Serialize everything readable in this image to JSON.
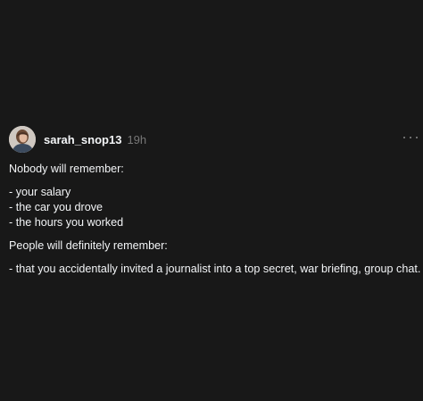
{
  "post": {
    "username": "sarah_snop13",
    "time": "19h",
    "avatar_icon": "profile-photo",
    "more_icon": "ellipsis-horizontal-icon",
    "paragraph_1": "Nobody will remember:",
    "list_1": [
      "- your salary",
      "- the car you drove",
      "- the hours you worked"
    ],
    "paragraph_2": "People will definitely remember:",
    "paragraph_3": "- that you accidentally invited a journalist into a top secret, war briefing, group chat."
  },
  "colors": {
    "background": "#181818",
    "text": "#f3f5f7",
    "muted": "#777777"
  }
}
